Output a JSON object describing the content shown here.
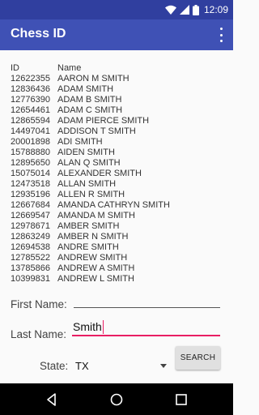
{
  "status_bar": {
    "time": "12:09",
    "icons": [
      "wifi-icon",
      "signal-icon",
      "battery-icon"
    ]
  },
  "app_bar": {
    "title": "Chess ID",
    "menu_icon": "more-vert-icon"
  },
  "results": {
    "columns": {
      "id": "ID",
      "name": "Name"
    },
    "rows": [
      {
        "id": "12622355",
        "name": "AARON M SMITH"
      },
      {
        "id": "12836436",
        "name": "ADAM SMITH"
      },
      {
        "id": "12776390",
        "name": "ADAM B SMITH"
      },
      {
        "id": "12654461",
        "name": "ADAM C SMITH"
      },
      {
        "id": "12865594",
        "name": "ADAM PIERCE SMITH"
      },
      {
        "id": "14497041",
        "name": "ADDISON T SMITH"
      },
      {
        "id": "20001898",
        "name": "ADI SMITH"
      },
      {
        "id": "15788880",
        "name": "AIDEN SMITH"
      },
      {
        "id": "12895650",
        "name": "ALAN Q SMITH"
      },
      {
        "id": "15075014",
        "name": "ALEXANDER SMITH"
      },
      {
        "id": "12473518",
        "name": "ALLAN SMITH"
      },
      {
        "id": "12935196",
        "name": "ALLEN R SMITH"
      },
      {
        "id": "12667684",
        "name": "AMANDA CATHRYN SMITH"
      },
      {
        "id": "12669547",
        "name": "AMANDA M SMITH"
      },
      {
        "id": "12978671",
        "name": "AMBER SMITH"
      },
      {
        "id": "12863249",
        "name": "AMBER N SMITH"
      },
      {
        "id": "12694538",
        "name": "ANDRE SMITH"
      },
      {
        "id": "12785522",
        "name": "ANDREW SMITH"
      },
      {
        "id": "13785866",
        "name": "ANDREW A SMITH"
      },
      {
        "id": "10399831",
        "name": "ANDREW L SMITH"
      }
    ]
  },
  "form": {
    "first_name_label": "First Name:",
    "first_name_value": "",
    "last_name_label": "Last Name:",
    "last_name_value": "Smith",
    "state_label": "State:",
    "state_value": "TX",
    "search_label": "SEARCH",
    "accent_color": "#e91e63"
  },
  "colors": {
    "primary": "#3f51b5",
    "primary_dark": "#303f9f",
    "accent": "#e91e63"
  },
  "nav_bar": {
    "buttons": [
      "back-icon",
      "home-icon",
      "recent-apps-icon"
    ]
  }
}
